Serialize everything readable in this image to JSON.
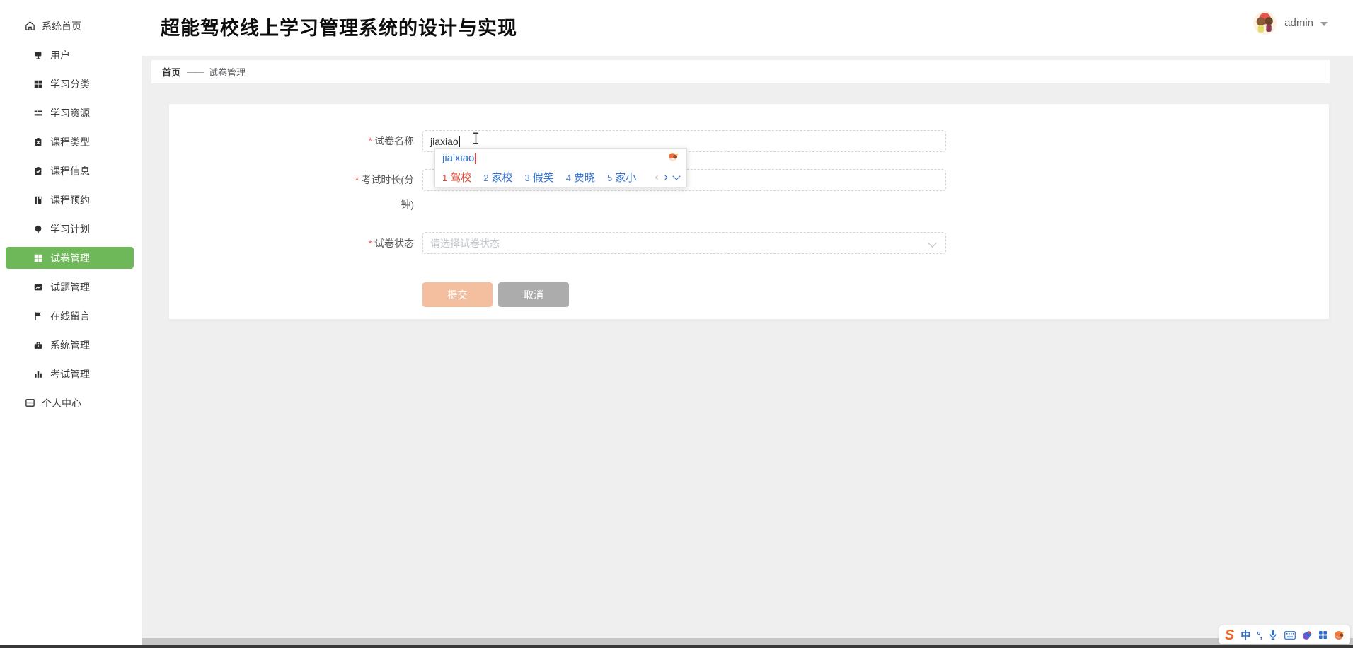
{
  "app": {
    "title": "超能驾校线上学习管理系统的设计与实现"
  },
  "user": {
    "name": "admin"
  },
  "sidebar": {
    "active": "试卷管理",
    "items": [
      {
        "label": "系统首页"
      },
      {
        "label": "用户"
      },
      {
        "label": "学习分类"
      },
      {
        "label": "学习资源"
      },
      {
        "label": "课程类型"
      },
      {
        "label": "课程信息"
      },
      {
        "label": "课程预约"
      },
      {
        "label": "学习计划"
      },
      {
        "label": "试卷管理"
      },
      {
        "label": "试题管理"
      },
      {
        "label": "在线留言"
      },
      {
        "label": "系统管理"
      },
      {
        "label": "考试管理"
      },
      {
        "label": "个人中心"
      }
    ]
  },
  "breadcrumb": {
    "home": "首页",
    "separator": "——",
    "current": "试卷管理"
  },
  "form": {
    "required_mark": "*",
    "fields": [
      {
        "label": "试卷名称",
        "value": "jiaxiao"
      },
      {
        "label": "考试时长(分钟)",
        "value": ""
      },
      {
        "label": "试卷状态",
        "placeholder": "请选择试卷状态"
      }
    ],
    "submit_label": "提交",
    "cancel_label": "取消"
  },
  "ime": {
    "composition": "jia'xiao",
    "candidates": [
      {
        "n": "1",
        "text": "驾校"
      },
      {
        "n": "2",
        "text": "家校"
      },
      {
        "n": "3",
        "text": "假笑"
      },
      {
        "n": "4",
        "text": "贾晓"
      },
      {
        "n": "5",
        "text": "家小"
      }
    ],
    "prev": "‹",
    "next": "›"
  },
  "ime_toolbar": {
    "logo": "S",
    "mode": "中",
    "punct": "°,"
  },
  "colors": {
    "accent_green": "#6fb85a",
    "submit_orange": "#f4bf9f",
    "cancel_gray": "#acacac",
    "candidate_red": "#e2452f",
    "ime_blue": "#2f6fd3",
    "content_bg": "#efefef"
  }
}
